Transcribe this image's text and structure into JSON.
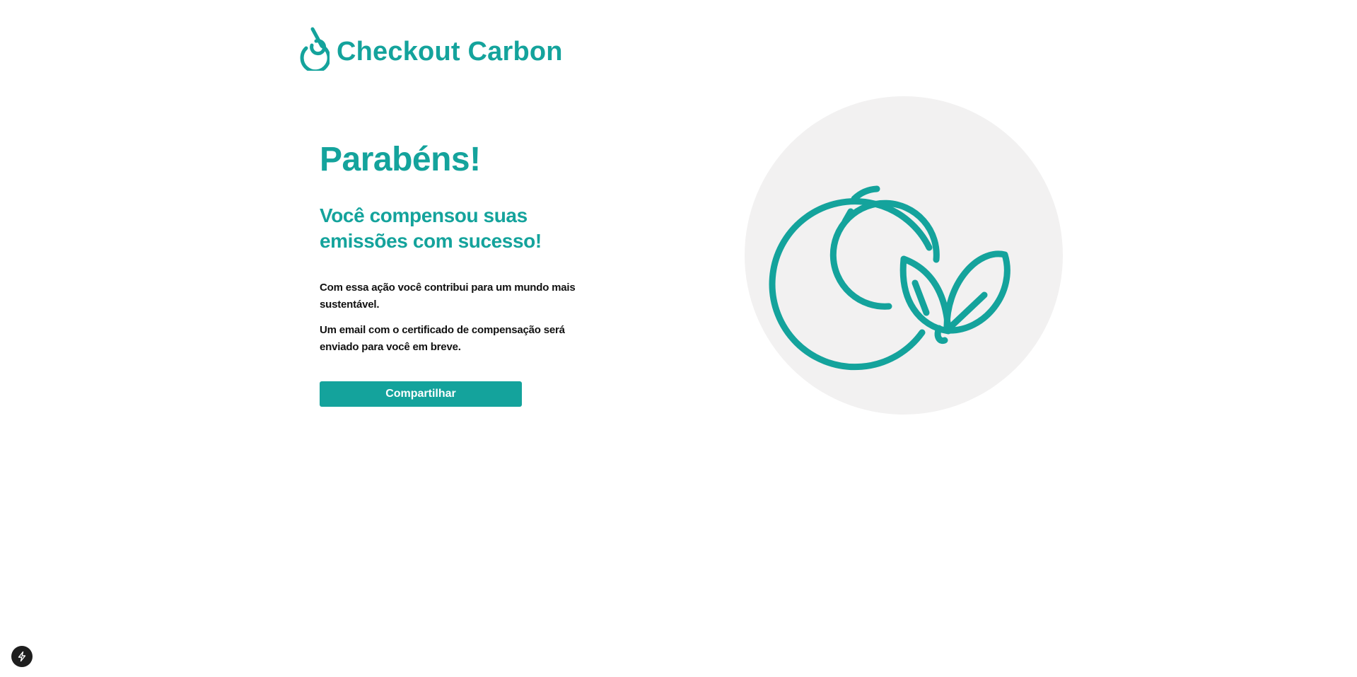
{
  "brand": {
    "name": "Checkout Carbon",
    "logo_icon": "drop-icon",
    "accent_color": "#14a39c"
  },
  "success": {
    "title": "Parabéns!",
    "subtitle": "Você compensou suas emissões com sucesso!",
    "paragraphs": [
      "Com essa ação você contribui para um mundo mais sustentável.",
      "Um email com o certificado de compensação será enviado para você em breve."
    ],
    "share_label": "Compartilhar"
  },
  "illustration": {
    "icon": "planet-leaves-icon",
    "background_color": "#f2f1f1"
  },
  "dev_badge": {
    "icon": "lightning-bolt-icon"
  }
}
